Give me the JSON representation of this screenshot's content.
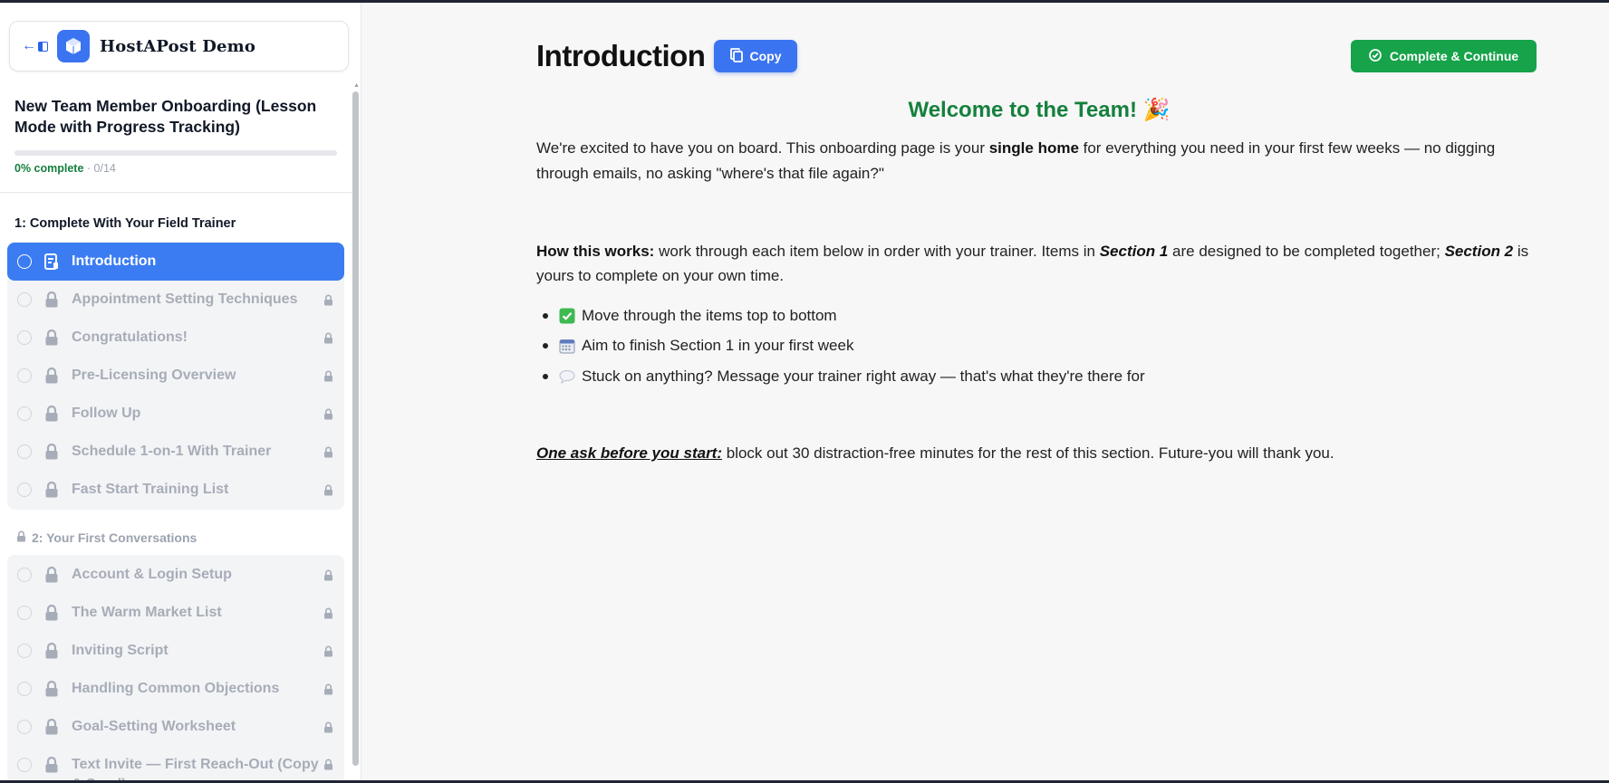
{
  "brand": {
    "name": "HostAPost Demo"
  },
  "course": {
    "title": "New Team Member Onboarding (Lesson Mode with Progress Tracking)",
    "progress_pct_label": "0% complete",
    "progress_count": " · 0/14",
    "progress_fraction": 0
  },
  "sections": [
    {
      "title": "1: Complete With Your Field Trainer",
      "lessons": [
        "Introduction",
        "Appointment Setting Techniques",
        "Congratulations!",
        "Pre-Licensing Overview",
        "Follow Up",
        "Schedule 1-on-1 With Trainer",
        "Fast Start Training List"
      ]
    },
    {
      "title": "2: Your First Conversations",
      "lessons": [
        "Account & Login Setup",
        "The Warm Market List",
        "Inviting Script",
        "Handling Common Objections",
        "Goal-Setting Worksheet",
        "Text Invite — First Reach-Out (Copy & Send)"
      ]
    }
  ],
  "main": {
    "title": "Introduction",
    "copy_label": "Copy",
    "complete_label": "Complete & Continue",
    "welcome": "Welcome to the Team! 🎉",
    "p1_a": "We're excited to have you on board. This onboarding page is your ",
    "p1_b": "single home",
    "p1_c": " for everything you need in your first few weeks — no digging through emails, no asking \"where's that file again?\"",
    "p2_a": "How this works:",
    "p2_b": " work through each item below in order with your trainer. Items in ",
    "p2_c": "Section 1",
    "p2_d": " are designed to be completed together; ",
    "p2_e": "Section 2",
    "p2_f": " is yours to complete on your own time.",
    "bullets": [
      "Move through the items top to bottom",
      "Aim to finish Section 1 in your first week",
      "Stuck on anything? Message your trainer right away — that's what they're there for"
    ],
    "p3_a": "One ask before you start:",
    "p3_b": " block out 30 distraction-free minutes for the rest of this section. Future-you will thank you."
  },
  "colors": {
    "accent": "#3b74f0",
    "success": "#16a34a",
    "welcome": "#15803d"
  },
  "icons": [
    "back-arrow-icon",
    "sidebar-panel-icon",
    "cube-logo-icon",
    "copy-icon",
    "check-circle-icon",
    "lesson-doc-icon",
    "lock-icon",
    "check-box-emoji",
    "calendar-emoji",
    "speech-bubble-emoji"
  ]
}
